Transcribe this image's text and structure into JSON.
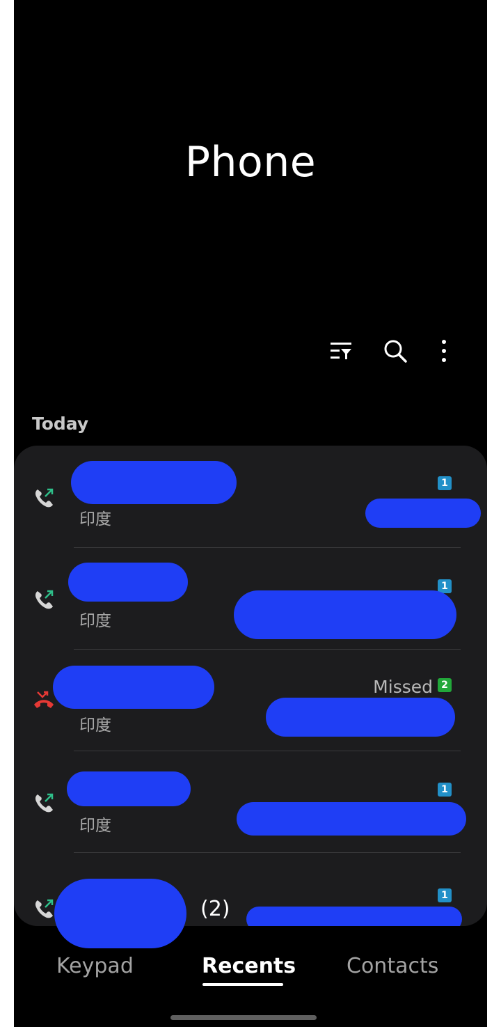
{
  "header": {
    "title": "Phone"
  },
  "toolbar": {
    "filter_icon": "filter-list-icon",
    "search_icon": "search-icon",
    "more_icon": "more-vert-icon"
  },
  "section": {
    "label": "Today"
  },
  "calls": [
    {
      "type": "outgoing",
      "location": "印度",
      "count": "1",
      "status": ""
    },
    {
      "type": "outgoing",
      "location": "印度",
      "count": "1",
      "status": ""
    },
    {
      "type": "missed",
      "location": "印度",
      "count": "2",
      "status": "Missed"
    },
    {
      "type": "outgoing",
      "location": "印度",
      "count": "1",
      "status": ""
    },
    {
      "type": "outgoing",
      "location": "",
      "count": "1",
      "status": "",
      "group_count": "(2)"
    }
  ],
  "bottom_nav": {
    "tabs": [
      {
        "label": "Keypad",
        "active": false
      },
      {
        "label": "Recents",
        "active": true
      },
      {
        "label": "Contacts",
        "active": false
      }
    ]
  },
  "colors": {
    "background": "#000000",
    "card": "#1c1c1e",
    "outgoing_arrow": "#2fbf8a",
    "missed": "#e53935",
    "badge_blue": "#2290c8",
    "badge_green": "#22a83a",
    "redaction": "#1f3ef5"
  }
}
